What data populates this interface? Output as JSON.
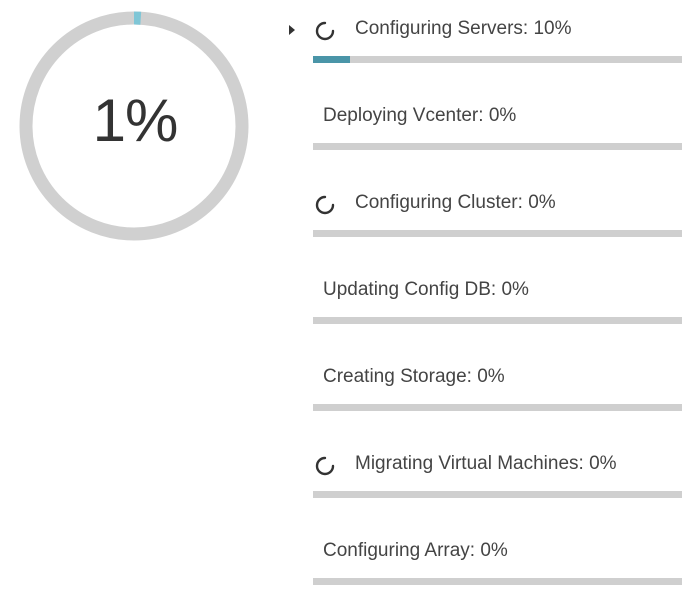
{
  "overall": {
    "percent_text": "1%",
    "progress": 0.01,
    "track_color": "#d0d0d0",
    "fill_color": "#7fc6d6"
  },
  "tasks": [
    {
      "label": "Configuring Servers: 10%",
      "progress": 0.1,
      "active": true,
      "spinner": true
    },
    {
      "label": "Deploying Vcenter: 0%",
      "progress": 0,
      "active": false,
      "spinner": false
    },
    {
      "label": "Configuring Cluster: 0%",
      "progress": 0,
      "active": false,
      "spinner": true
    },
    {
      "label": "Updating Config DB: 0%",
      "progress": 0,
      "active": false,
      "spinner": false
    },
    {
      "label": "Creating Storage: 0%",
      "progress": 0,
      "active": false,
      "spinner": false
    },
    {
      "label": "Migrating Virtual Machines: 0%",
      "progress": 0,
      "active": false,
      "spinner": true
    },
    {
      "label": "Configuring Array: 0%",
      "progress": 0,
      "active": false,
      "spinner": false
    }
  ],
  "colors": {
    "bar_track": "#cfcfcf",
    "bar_fill": "#4a95a8",
    "text": "#444444"
  },
  "icons": {
    "spinner": "spinner-icon",
    "expand": "caret-right-icon"
  }
}
